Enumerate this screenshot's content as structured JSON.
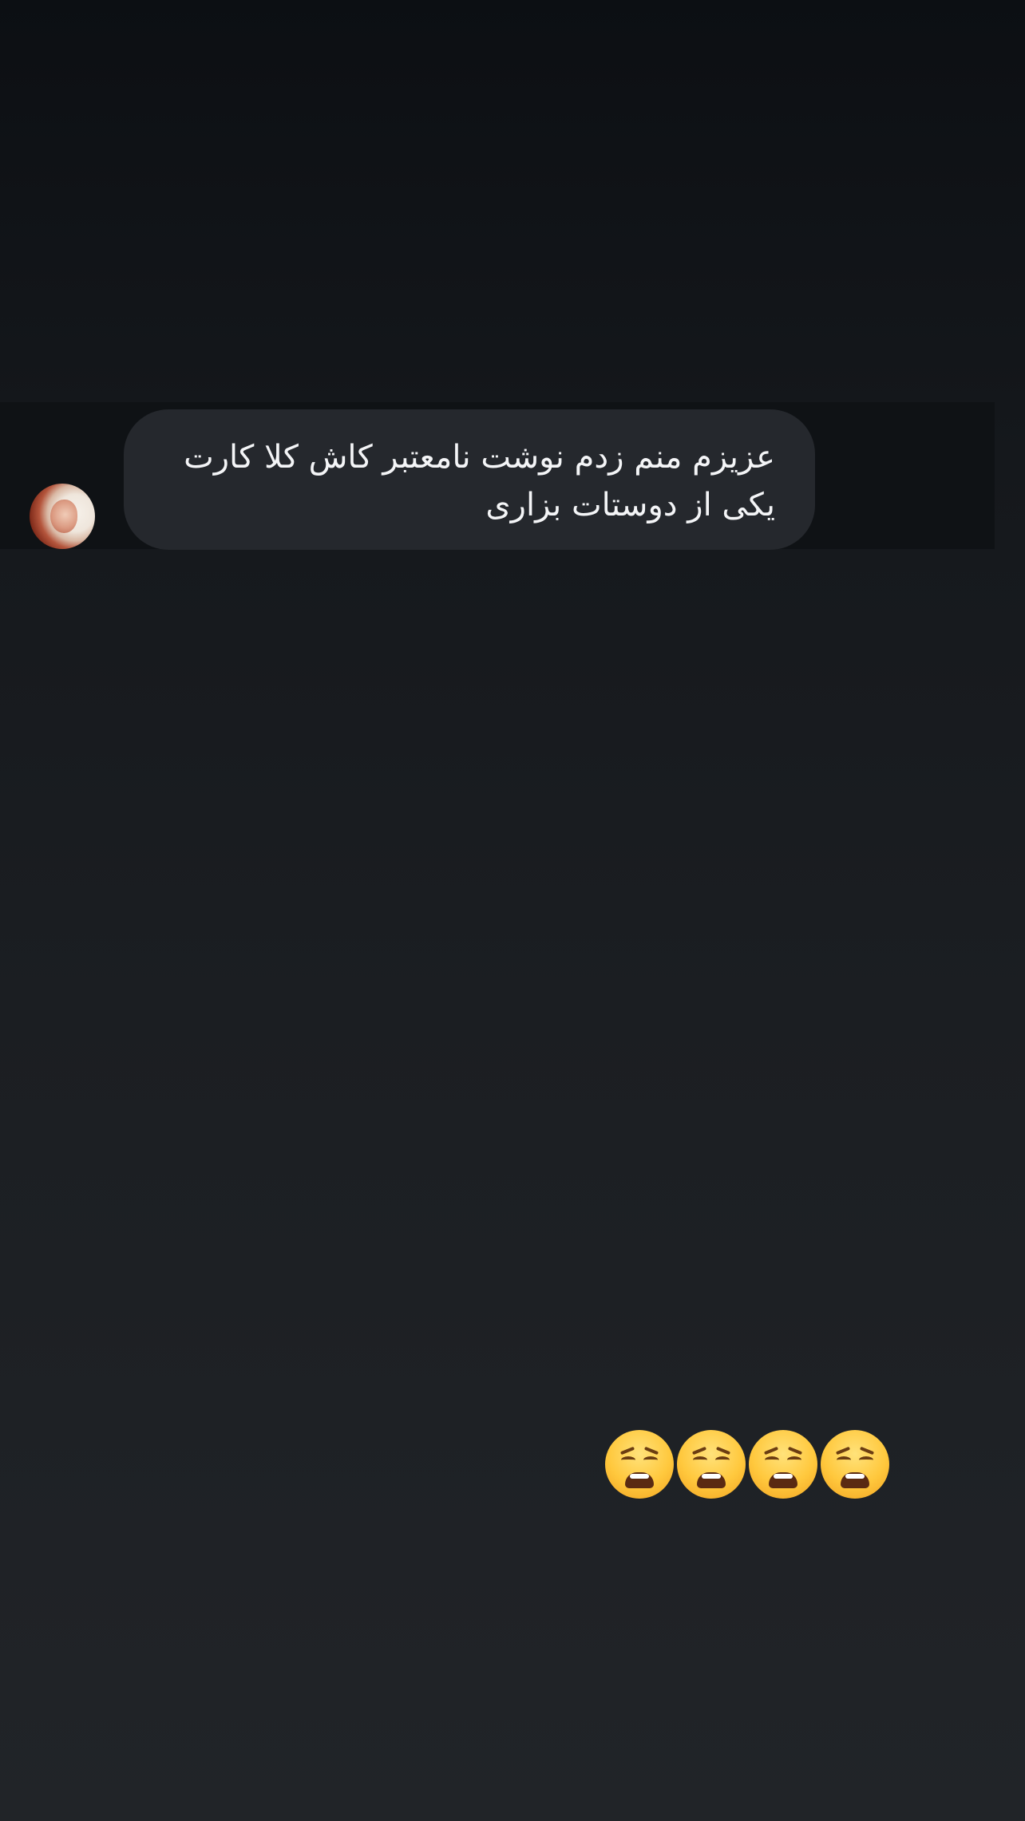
{
  "message": {
    "lines": [
      "عزیزم منم زدم نوشت نامعتبر کاش کلا کارت",
      "یکی از دوستات بزاری"
    ]
  },
  "reaction": {
    "emoji": "😩😩😩😩",
    "icons": [
      "weary-face-emoji",
      "weary-face-emoji",
      "weary-face-emoji",
      "weary-face-emoji"
    ]
  }
}
